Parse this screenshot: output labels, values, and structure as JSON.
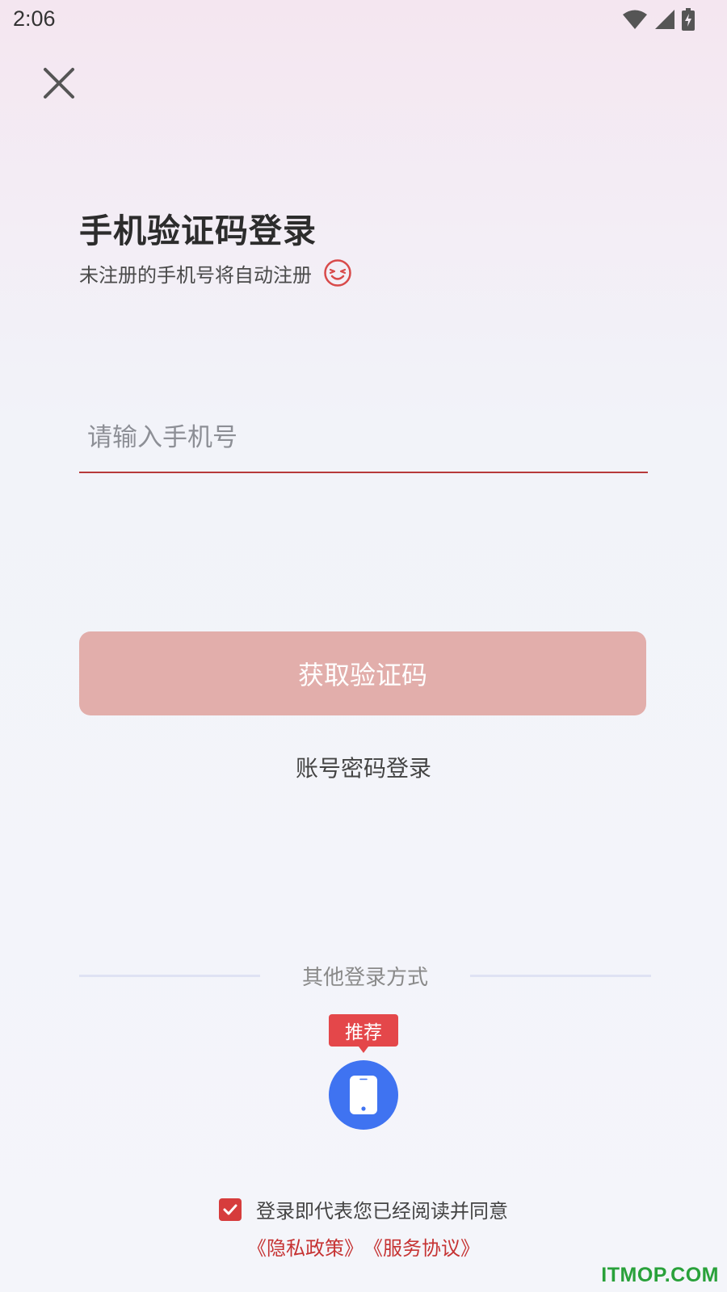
{
  "status_bar": {
    "time": "2:06",
    "icons": [
      "wifi-icon",
      "cell-signal-icon",
      "battery-charging-icon"
    ]
  },
  "header": {
    "close_icon": "close-icon",
    "title": "手机验证码登录",
    "subtitle": "未注册的手机号将自动注册",
    "emoji_icon": "smiley-icon"
  },
  "form": {
    "phone_placeholder": "请输入手机号",
    "phone_value": "",
    "get_code_label": "获取验证码",
    "password_login_label": "账号密码登录"
  },
  "other_login": {
    "divider_label": "其他登录方式",
    "recommend_badge": "推荐",
    "phone_method_icon": "mobile-phone-icon"
  },
  "agreement": {
    "checked": true,
    "text": "登录即代表您已经阅读并同意",
    "privacy_policy": "《隐私政策》",
    "service_agreement": "《服务协议》"
  },
  "watermark": "ITMOP.COM",
  "colors": {
    "accent_red": "#d63c3c",
    "button_disabled": "#e2aeab",
    "phone_blue": "#3f73f1",
    "badge_red": "#e4474a",
    "watermark_green": "#29a13a"
  }
}
